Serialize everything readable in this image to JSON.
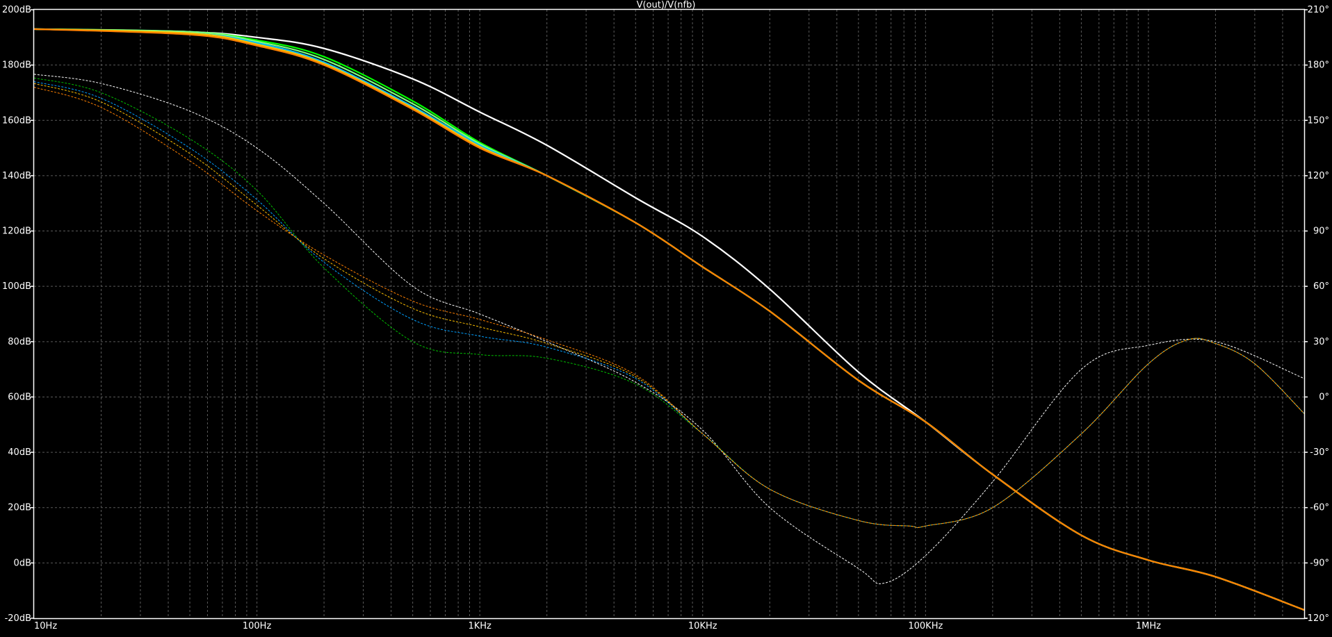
{
  "chart_data": {
    "type": "line",
    "title": "V(out)/V(nfb)",
    "x_scale": "log",
    "xlim": [
      10,
      5000000
    ],
    "ylim_left": [
      -20,
      200
    ],
    "ylim_right": [
      -120,
      210
    ],
    "grid": true,
    "x_ticks": [
      {
        "v": 10,
        "label": "10Hz"
      },
      {
        "v": 100,
        "label": "100Hz"
      },
      {
        "v": 1000,
        "label": "1KHz"
      },
      {
        "v": 10000,
        "label": "10KHz"
      },
      {
        "v": 100000,
        "label": "100KHz"
      },
      {
        "v": 1000000,
        "label": "1MHz"
      }
    ],
    "y_left_ticks": [
      {
        "v": 200,
        "label": "200dB"
      },
      {
        "v": 180,
        "label": "180dB"
      },
      {
        "v": 160,
        "label": "160dB"
      },
      {
        "v": 140,
        "label": "140dB"
      },
      {
        "v": 120,
        "label": "120dB"
      },
      {
        "v": 100,
        "label": "100dB"
      },
      {
        "v": 80,
        "label": "80dB"
      },
      {
        "v": 60,
        "label": "60dB"
      },
      {
        "v": 40,
        "label": "40dB"
      },
      {
        "v": 20,
        "label": "20dB"
      },
      {
        "v": 0,
        "label": "0dB"
      },
      {
        "v": -20,
        "label": "-20dB"
      }
    ],
    "y_right_ticks": [
      {
        "v": 210,
        "label": "210°"
      },
      {
        "v": 180,
        "label": "180°"
      },
      {
        "v": 150,
        "label": "150°"
      },
      {
        "v": 120,
        "label": "120°"
      },
      {
        "v": 90,
        "label": "90°"
      },
      {
        "v": 60,
        "label": "60°"
      },
      {
        "v": 30,
        "label": "30°"
      },
      {
        "v": 0,
        "label": "0°"
      },
      {
        "v": -30,
        "label": "-30°"
      },
      {
        "v": -60,
        "label": "-60°"
      },
      {
        "v": -90,
        "label": "-90°"
      },
      {
        "v": -120,
        "label": "-120°"
      }
    ],
    "magnitude_series": [
      {
        "color": "#ffffff",
        "points": [
          [
            10,
            193
          ],
          [
            50,
            192
          ],
          [
            100,
            190
          ],
          [
            200,
            186
          ],
          [
            500,
            175
          ],
          [
            1000,
            163
          ],
          [
            2000,
            151
          ],
          [
            5000,
            132
          ],
          [
            10000,
            118
          ],
          [
            20000,
            99
          ],
          [
            50000,
            69
          ],
          [
            100000,
            51
          ],
          [
            200000,
            32
          ],
          [
            500000,
            10
          ],
          [
            1000000,
            1
          ],
          [
            2000000,
            -5
          ],
          [
            5000000,
            -17
          ]
        ]
      },
      {
        "color": "#00ff00",
        "points": [
          [
            10,
            193
          ],
          [
            50,
            192
          ],
          [
            100,
            189
          ],
          [
            200,
            183
          ],
          [
            500,
            167
          ],
          [
            1000,
            152
          ],
          [
            2000,
            140
          ],
          [
            5000,
            123
          ],
          [
            10000,
            107
          ],
          [
            20000,
            91
          ],
          [
            50000,
            66
          ],
          [
            100000,
            51
          ],
          [
            200000,
            32
          ],
          [
            500000,
            10
          ],
          [
            1000000,
            1
          ],
          [
            2000000,
            -5
          ],
          [
            5000000,
            -17
          ]
        ]
      },
      {
        "color": "#80ff80",
        "points": [
          [
            10,
            193
          ],
          [
            50,
            192
          ],
          [
            100,
            188.5
          ],
          [
            200,
            182
          ],
          [
            500,
            166
          ],
          [
            1000,
            151.5
          ],
          [
            2000,
            140
          ],
          [
            5000,
            123
          ],
          [
            10000,
            107
          ],
          [
            20000,
            91
          ],
          [
            50000,
            66
          ],
          [
            100000,
            51
          ],
          [
            200000,
            32
          ],
          [
            500000,
            10
          ],
          [
            1000000,
            1
          ],
          [
            2000000,
            -5
          ],
          [
            5000000,
            -17
          ]
        ]
      },
      {
        "color": "#00c0ff",
        "points": [
          [
            10,
            193
          ],
          [
            50,
            191.5
          ],
          [
            100,
            188
          ],
          [
            200,
            181
          ],
          [
            500,
            165
          ],
          [
            1000,
            151
          ],
          [
            2000,
            140
          ],
          [
            5000,
            123
          ],
          [
            10000,
            107
          ],
          [
            20000,
            91
          ],
          [
            50000,
            66
          ],
          [
            100000,
            51
          ],
          [
            200000,
            32
          ],
          [
            500000,
            10
          ],
          [
            1000000,
            1
          ],
          [
            2000000,
            -5
          ],
          [
            5000000,
            -17
          ]
        ]
      },
      {
        "color": "#ffc000",
        "points": [
          [
            10,
            193
          ],
          [
            50,
            191.5
          ],
          [
            100,
            187.5
          ],
          [
            200,
            180.5
          ],
          [
            500,
            164.5
          ],
          [
            1000,
            150.5
          ],
          [
            2000,
            140
          ],
          [
            5000,
            123
          ],
          [
            10000,
            107
          ],
          [
            20000,
            91
          ],
          [
            50000,
            66
          ],
          [
            100000,
            51
          ],
          [
            200000,
            32
          ],
          [
            500000,
            10
          ],
          [
            1000000,
            1
          ],
          [
            2000000,
            -5
          ],
          [
            5000000,
            -17
          ]
        ]
      },
      {
        "color": "#ff8000",
        "points": [
          [
            10,
            193
          ],
          [
            50,
            191
          ],
          [
            100,
            187
          ],
          [
            200,
            180
          ],
          [
            500,
            164
          ],
          [
            1000,
            150
          ],
          [
            2000,
            140
          ],
          [
            5000,
            123
          ],
          [
            10000,
            107
          ],
          [
            20000,
            91
          ],
          [
            50000,
            66
          ],
          [
            100000,
            51
          ],
          [
            200000,
            32
          ],
          [
            500000,
            10
          ],
          [
            1000000,
            1
          ],
          [
            2000000,
            -5
          ],
          [
            5000000,
            -17
          ]
        ]
      }
    ],
    "phase_series": [
      {
        "color": "#ffffff",
        "points": [
          [
            10,
            175
          ],
          [
            20,
            170
          ],
          [
            50,
            155
          ],
          [
            100,
            135
          ],
          [
            200,
            105
          ],
          [
            500,
            60
          ],
          [
            1000,
            45
          ],
          [
            2000,
            30
          ],
          [
            5000,
            8
          ],
          [
            10000,
            -18
          ],
          [
            20000,
            -60
          ],
          [
            50000,
            -93
          ],
          [
            65000,
            -101
          ],
          [
            100000,
            -86
          ],
          [
            200000,
            -46
          ],
          [
            500000,
            15
          ],
          [
            1000000,
            28
          ],
          [
            2000000,
            30
          ],
          [
            5000000,
            10
          ]
        ]
      },
      {
        "color": "#00c000",
        "points": [
          [
            10,
            173
          ],
          [
            20,
            165
          ],
          [
            50,
            140
          ],
          [
            100,
            112
          ],
          [
            200,
            70
          ],
          [
            500,
            30
          ],
          [
            1000,
            23
          ],
          [
            2000,
            21
          ],
          [
            5000,
            7
          ],
          [
            10000,
            -20
          ],
          [
            20000,
            -50
          ],
          [
            50000,
            -67
          ],
          [
            85000,
            -70
          ],
          [
            100000,
            -70
          ],
          [
            200000,
            -60
          ],
          [
            500000,
            -20
          ],
          [
            1000000,
            18
          ],
          [
            1500000,
            31
          ],
          [
            2000000,
            29
          ],
          [
            3000000,
            18
          ],
          [
            5000000,
            -9
          ]
        ]
      },
      {
        "color": "#00a0ff",
        "points": [
          [
            10,
            171
          ],
          [
            20,
            162
          ],
          [
            50,
            135
          ],
          [
            100,
            107
          ],
          [
            200,
            73
          ],
          [
            500,
            42
          ],
          [
            1000,
            33
          ],
          [
            2000,
            27
          ],
          [
            5000,
            10
          ],
          [
            10000,
            -20
          ],
          [
            20000,
            -50
          ],
          [
            50000,
            -67
          ],
          [
            85000,
            -70
          ],
          [
            100000,
            -70
          ],
          [
            200000,
            -60
          ],
          [
            500000,
            -20
          ],
          [
            1000000,
            18
          ],
          [
            1500000,
            31
          ],
          [
            2000000,
            29
          ],
          [
            3000000,
            18
          ],
          [
            5000000,
            -9
          ]
        ]
      },
      {
        "color": "#ffc000",
        "points": [
          [
            10,
            170
          ],
          [
            20,
            160
          ],
          [
            50,
            132
          ],
          [
            100,
            104
          ],
          [
            200,
            75
          ],
          [
            500,
            48
          ],
          [
            1000,
            38
          ],
          [
            2000,
            29
          ],
          [
            5000,
            11
          ],
          [
            10000,
            -20
          ],
          [
            20000,
            -50
          ],
          [
            50000,
            -67
          ],
          [
            85000,
            -70
          ],
          [
            100000,
            -70
          ],
          [
            200000,
            -60
          ],
          [
            500000,
            -20
          ],
          [
            1000000,
            18
          ],
          [
            1500000,
            31
          ],
          [
            2000000,
            29
          ],
          [
            3000000,
            18
          ],
          [
            5000000,
            -9
          ]
        ]
      },
      {
        "color": "#ff8000",
        "points": [
          [
            10,
            168
          ],
          [
            20,
            157
          ],
          [
            50,
            128
          ],
          [
            100,
            101
          ],
          [
            200,
            77
          ],
          [
            500,
            52
          ],
          [
            1000,
            42
          ],
          [
            2000,
            31
          ],
          [
            5000,
            12
          ],
          [
            10000,
            -20
          ],
          [
            20000,
            -50
          ],
          [
            50000,
            -67
          ],
          [
            85000,
            -70
          ],
          [
            100000,
            -70
          ],
          [
            200000,
            -60
          ],
          [
            500000,
            -20
          ],
          [
            1000000,
            18
          ],
          [
            1500000,
            31
          ],
          [
            2000000,
            29
          ],
          [
            3000000,
            18
          ],
          [
            5000000,
            -9
          ]
        ]
      }
    ]
  }
}
